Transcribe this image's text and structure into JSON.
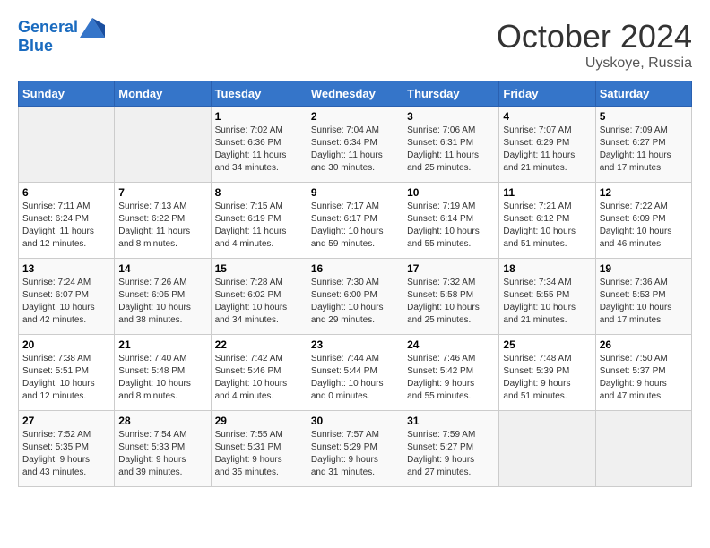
{
  "header": {
    "logo_line1": "General",
    "logo_line2": "Blue",
    "month": "October 2024",
    "location": "Uyskoye, Russia"
  },
  "days_of_week": [
    "Sunday",
    "Monday",
    "Tuesday",
    "Wednesday",
    "Thursday",
    "Friday",
    "Saturday"
  ],
  "weeks": [
    [
      {
        "day": "",
        "info": ""
      },
      {
        "day": "",
        "info": ""
      },
      {
        "day": "1",
        "info": "Sunrise: 7:02 AM\nSunset: 6:36 PM\nDaylight: 11 hours\nand 34 minutes."
      },
      {
        "day": "2",
        "info": "Sunrise: 7:04 AM\nSunset: 6:34 PM\nDaylight: 11 hours\nand 30 minutes."
      },
      {
        "day": "3",
        "info": "Sunrise: 7:06 AM\nSunset: 6:31 PM\nDaylight: 11 hours\nand 25 minutes."
      },
      {
        "day": "4",
        "info": "Sunrise: 7:07 AM\nSunset: 6:29 PM\nDaylight: 11 hours\nand 21 minutes."
      },
      {
        "day": "5",
        "info": "Sunrise: 7:09 AM\nSunset: 6:27 PM\nDaylight: 11 hours\nand 17 minutes."
      }
    ],
    [
      {
        "day": "6",
        "info": "Sunrise: 7:11 AM\nSunset: 6:24 PM\nDaylight: 11 hours\nand 12 minutes."
      },
      {
        "day": "7",
        "info": "Sunrise: 7:13 AM\nSunset: 6:22 PM\nDaylight: 11 hours\nand 8 minutes."
      },
      {
        "day": "8",
        "info": "Sunrise: 7:15 AM\nSunset: 6:19 PM\nDaylight: 11 hours\nand 4 minutes."
      },
      {
        "day": "9",
        "info": "Sunrise: 7:17 AM\nSunset: 6:17 PM\nDaylight: 10 hours\nand 59 minutes."
      },
      {
        "day": "10",
        "info": "Sunrise: 7:19 AM\nSunset: 6:14 PM\nDaylight: 10 hours\nand 55 minutes."
      },
      {
        "day": "11",
        "info": "Sunrise: 7:21 AM\nSunset: 6:12 PM\nDaylight: 10 hours\nand 51 minutes."
      },
      {
        "day": "12",
        "info": "Sunrise: 7:22 AM\nSunset: 6:09 PM\nDaylight: 10 hours\nand 46 minutes."
      }
    ],
    [
      {
        "day": "13",
        "info": "Sunrise: 7:24 AM\nSunset: 6:07 PM\nDaylight: 10 hours\nand 42 minutes."
      },
      {
        "day": "14",
        "info": "Sunrise: 7:26 AM\nSunset: 6:05 PM\nDaylight: 10 hours\nand 38 minutes."
      },
      {
        "day": "15",
        "info": "Sunrise: 7:28 AM\nSunset: 6:02 PM\nDaylight: 10 hours\nand 34 minutes."
      },
      {
        "day": "16",
        "info": "Sunrise: 7:30 AM\nSunset: 6:00 PM\nDaylight: 10 hours\nand 29 minutes."
      },
      {
        "day": "17",
        "info": "Sunrise: 7:32 AM\nSunset: 5:58 PM\nDaylight: 10 hours\nand 25 minutes."
      },
      {
        "day": "18",
        "info": "Sunrise: 7:34 AM\nSunset: 5:55 PM\nDaylight: 10 hours\nand 21 minutes."
      },
      {
        "day": "19",
        "info": "Sunrise: 7:36 AM\nSunset: 5:53 PM\nDaylight: 10 hours\nand 17 minutes."
      }
    ],
    [
      {
        "day": "20",
        "info": "Sunrise: 7:38 AM\nSunset: 5:51 PM\nDaylight: 10 hours\nand 12 minutes."
      },
      {
        "day": "21",
        "info": "Sunrise: 7:40 AM\nSunset: 5:48 PM\nDaylight: 10 hours\nand 8 minutes."
      },
      {
        "day": "22",
        "info": "Sunrise: 7:42 AM\nSunset: 5:46 PM\nDaylight: 10 hours\nand 4 minutes."
      },
      {
        "day": "23",
        "info": "Sunrise: 7:44 AM\nSunset: 5:44 PM\nDaylight: 10 hours\nand 0 minutes."
      },
      {
        "day": "24",
        "info": "Sunrise: 7:46 AM\nSunset: 5:42 PM\nDaylight: 9 hours\nand 55 minutes."
      },
      {
        "day": "25",
        "info": "Sunrise: 7:48 AM\nSunset: 5:39 PM\nDaylight: 9 hours\nand 51 minutes."
      },
      {
        "day": "26",
        "info": "Sunrise: 7:50 AM\nSunset: 5:37 PM\nDaylight: 9 hours\nand 47 minutes."
      }
    ],
    [
      {
        "day": "27",
        "info": "Sunrise: 7:52 AM\nSunset: 5:35 PM\nDaylight: 9 hours\nand 43 minutes."
      },
      {
        "day": "28",
        "info": "Sunrise: 7:54 AM\nSunset: 5:33 PM\nDaylight: 9 hours\nand 39 minutes."
      },
      {
        "day": "29",
        "info": "Sunrise: 7:55 AM\nSunset: 5:31 PM\nDaylight: 9 hours\nand 35 minutes."
      },
      {
        "day": "30",
        "info": "Sunrise: 7:57 AM\nSunset: 5:29 PM\nDaylight: 9 hours\nand 31 minutes."
      },
      {
        "day": "31",
        "info": "Sunrise: 7:59 AM\nSunset: 5:27 PM\nDaylight: 9 hours\nand 27 minutes."
      },
      {
        "day": "",
        "info": ""
      },
      {
        "day": "",
        "info": ""
      }
    ]
  ]
}
